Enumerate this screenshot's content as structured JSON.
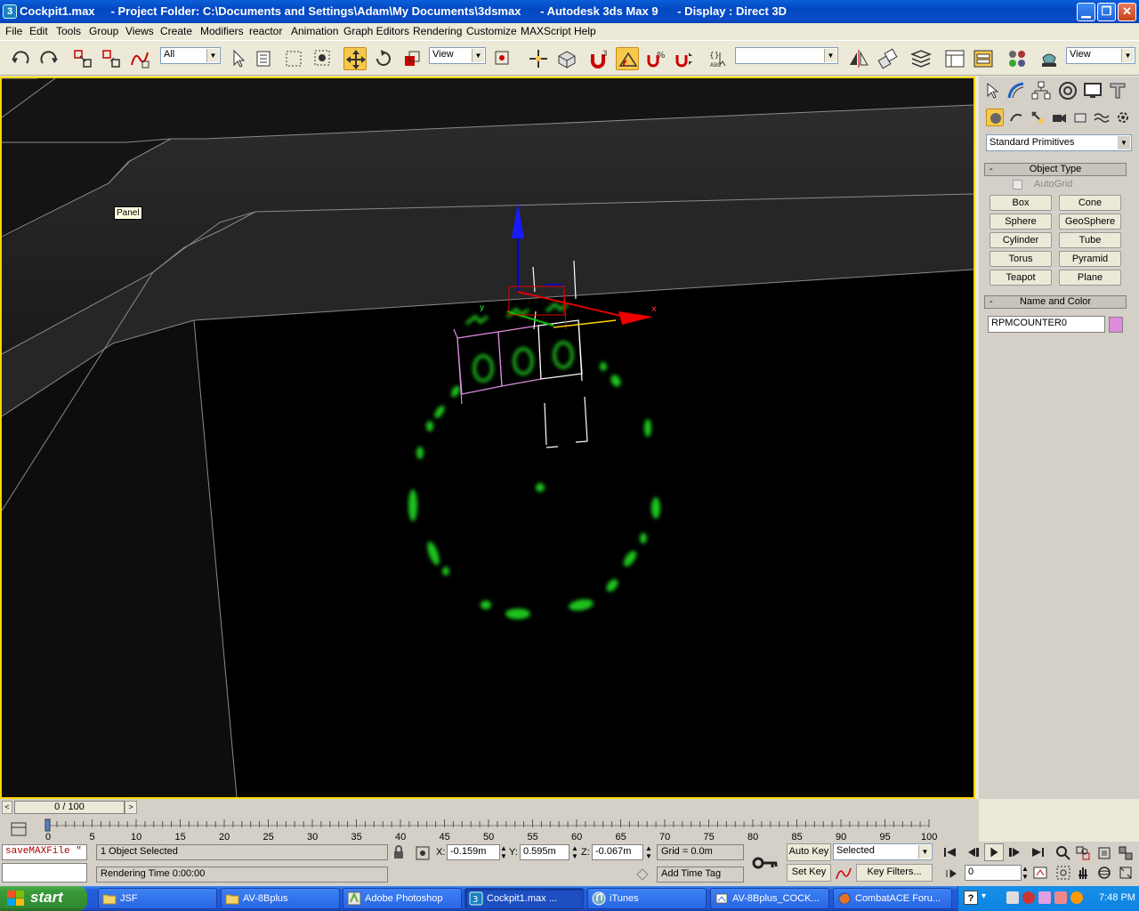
{
  "window": {
    "title": "Cockpit1.max     - Project Folder: C:\\Documents and Settings\\Adam\\My Documents\\3dsmax      - Autodesk 3ds Max 9      - Display : Direct 3D",
    "app_icon": "3"
  },
  "menu": [
    "File",
    "Edit",
    "Tools",
    "Group",
    "Views",
    "Create",
    "Modifiers",
    "reactor",
    "Animation",
    "Graph Editors",
    "Rendering",
    "Customize",
    "MAXScript",
    "Help"
  ],
  "toolbar": {
    "selection_filter": "All",
    "ref_coord": "View",
    "named_selection": "",
    "render_view": "View",
    "angle_snap_label": "3"
  },
  "viewport": {
    "tooltip": "Panel",
    "gizmo_x": "x",
    "gizmo_y": "y",
    "digits": [
      "0",
      "0",
      "0"
    ]
  },
  "command_panel": {
    "category": "Standard Primitives",
    "object_type_title": "Object Type",
    "autogrid_label": "AutoGrid",
    "primitives": [
      "Box",
      "Cone",
      "Sphere",
      "GeoSphere",
      "Cylinder",
      "Tube",
      "Torus",
      "Pyramid",
      "Teapot",
      "Plane"
    ],
    "name_color_title": "Name and Color",
    "object_name": "RPMCOUNTER0",
    "object_color": "#dc8cdc"
  },
  "time_slider": {
    "frame_label": "0 / 100",
    "ticks": [
      "0",
      "5",
      "10",
      "15",
      "20",
      "25",
      "30",
      "35",
      "40",
      "45",
      "50",
      "55",
      "60",
      "65",
      "70",
      "75",
      "80",
      "85",
      "90",
      "95",
      "100"
    ]
  },
  "status": {
    "maxscript_listener": "saveMAXFile \"",
    "selection_status": "1 Object Selected",
    "prompt": "Rendering Time  0:00:00",
    "x_label": "X:",
    "x_value": "-0.159m",
    "y_label": "Y:",
    "y_value": "0.595m",
    "z_label": "Z:",
    "z_value": "-0.067m",
    "grid": "Grid = 0.0m",
    "add_time_tag": "Add Time Tag",
    "auto_key": "Auto Key",
    "set_key": "Set Key",
    "key_mode": "Selected",
    "key_filters": "Key Filters...",
    "current_frame": "0"
  },
  "taskbar": {
    "start": "start",
    "tasks": [
      {
        "label": "JSF",
        "icon": "folder-icon"
      },
      {
        "label": "AV-8Bplus",
        "icon": "folder-icon"
      },
      {
        "label": "Adobe Photoshop",
        "icon": "photoshop-icon"
      },
      {
        "label": "Cockpit1.max      ...",
        "icon": "3dsmax-icon",
        "active": true
      },
      {
        "label": "iTunes",
        "icon": "itunes-icon"
      },
      {
        "label": "AV-8Bplus_COCK...",
        "icon": "paint-icon"
      },
      {
        "label": "CombatACE Foru...",
        "icon": "firefox-icon"
      }
    ],
    "clock": "7:48 PM"
  },
  "colors": {
    "viewport_border": "#f5d800",
    "led_green": "#1fc21f",
    "selection_box": "#dc8cdc",
    "gizmo_x": "#e00000",
    "gizmo_y": "#00c000",
    "gizmo_z": "#0000e0"
  }
}
